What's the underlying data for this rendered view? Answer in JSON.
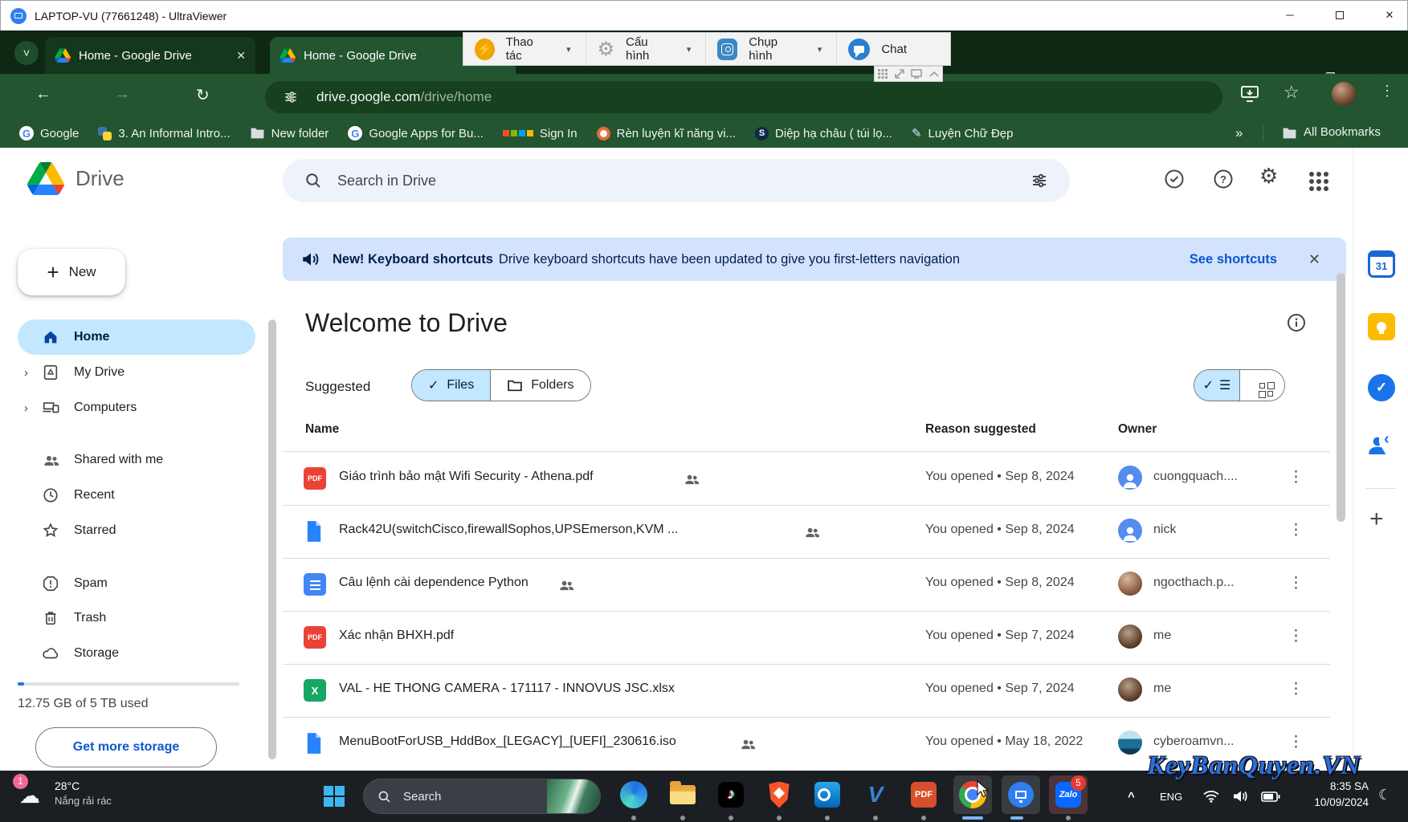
{
  "remote_window": {
    "title": "LAPTOP-VU (77661248) - UltraViewer"
  },
  "browser": {
    "tabs": [
      {
        "label": "Home - Google Drive"
      },
      {
        "label": "Home - Google Drive"
      }
    ],
    "url": {
      "host": "drive.google.com",
      "path": "/drive/home"
    },
    "bookmarks_bar": {
      "items": [
        {
          "label": "Google"
        },
        {
          "label": "3. An Informal Intro..."
        },
        {
          "label": "New folder"
        },
        {
          "label": "Google Apps for Bu..."
        },
        {
          "label": "Sign In"
        },
        {
          "label": "Rèn luyện kĩ năng vi..."
        },
        {
          "label": "Diệp hạ châu ( túi lọ..."
        },
        {
          "label": "Luyện Chữ Đẹp"
        }
      ],
      "overflow": "»",
      "all_bookmarks": "All Bookmarks"
    }
  },
  "capture_toolbar": {
    "actions": [
      {
        "label": "Thao tác"
      },
      {
        "label": "Cấu hình"
      },
      {
        "label": "Chụp hình"
      },
      {
        "label": "Chat"
      }
    ]
  },
  "drive": {
    "product_name": "Drive",
    "search": {
      "placeholder": "Search in Drive"
    },
    "notification_banner": {
      "title": "New! Keyboard shortcuts",
      "message": "Drive keyboard shortcuts have been updated to give you first-letters navigation",
      "action": "See shortcuts"
    },
    "new_button": "New",
    "sidebar": {
      "items": [
        {
          "label": "Home"
        },
        {
          "label": "My Drive"
        },
        {
          "label": "Computers"
        },
        {
          "label": "Shared with me"
        },
        {
          "label": "Recent"
        },
        {
          "label": "Starred"
        },
        {
          "label": "Spam"
        },
        {
          "label": "Trash"
        },
        {
          "label": "Storage"
        }
      ],
      "storage_usage": "12.75 GB of 5 TB used",
      "storage_button": "Get more storage"
    },
    "main": {
      "heading": "Welcome to Drive",
      "suggested_label": "Suggested",
      "filter_chips": [
        {
          "label": "Files"
        },
        {
          "label": "Folders"
        }
      ],
      "table_headers": [
        "Name",
        "Reason suggested",
        "Owner"
      ],
      "rows": [
        {
          "name": "Giáo trình bảo mật Wifi Security - Athena.pdf",
          "file_type": "pdf",
          "reason": "You opened • Sep 8, 2024",
          "owner": "cuongquach...."
        },
        {
          "name": "Rack42U(switchCisco,firewallSophos,UPSEmerson,KVM ...",
          "file_type": "file",
          "reason": "You opened • Sep 8, 2024",
          "owner": "nick"
        },
        {
          "name": "Câu lệnh cài dependence Python",
          "file_type": "docs",
          "reason": "You opened • Sep 8, 2024",
          "owner": "ngocthach.p..."
        },
        {
          "name": "Xác nhận BHXH.pdf",
          "file_type": "pdf",
          "reason": "You opened • Sep 7, 2024",
          "owner": "me"
        },
        {
          "name": "VAL - HE THONG CAMERA  - 171117 - INNOVUS JSC.xlsx",
          "file_type": "xlsx",
          "reason": "You opened • Sep 7, 2024",
          "owner": "me"
        },
        {
          "name": "MenuBootForUSB_HddBox_[LEGACY]_[UEFI]_230616.iso",
          "file_type": "file",
          "reason": "You opened • May 18, 2022",
          "owner": "cyberoamvn..."
        }
      ]
    }
  },
  "taskbar": {
    "weather": {
      "badge": "1",
      "temp": "28°C",
      "condition": "Nắng rải rác"
    },
    "search_label": "Search",
    "pdf_app_label": "PDF",
    "zalo": {
      "label": "Zalo",
      "badge": "5"
    },
    "tray": {
      "language": "ENG",
      "time": "8:35 SA",
      "date": "10/09/2024"
    }
  },
  "watermark": "KeyBanQuyen.VN",
  "colors": {
    "chrome_theme_green": "#225530",
    "selection_blue": "#c2e7ff",
    "banner_blue": "#d3e3fd",
    "link_blue": "#0b57d0"
  }
}
